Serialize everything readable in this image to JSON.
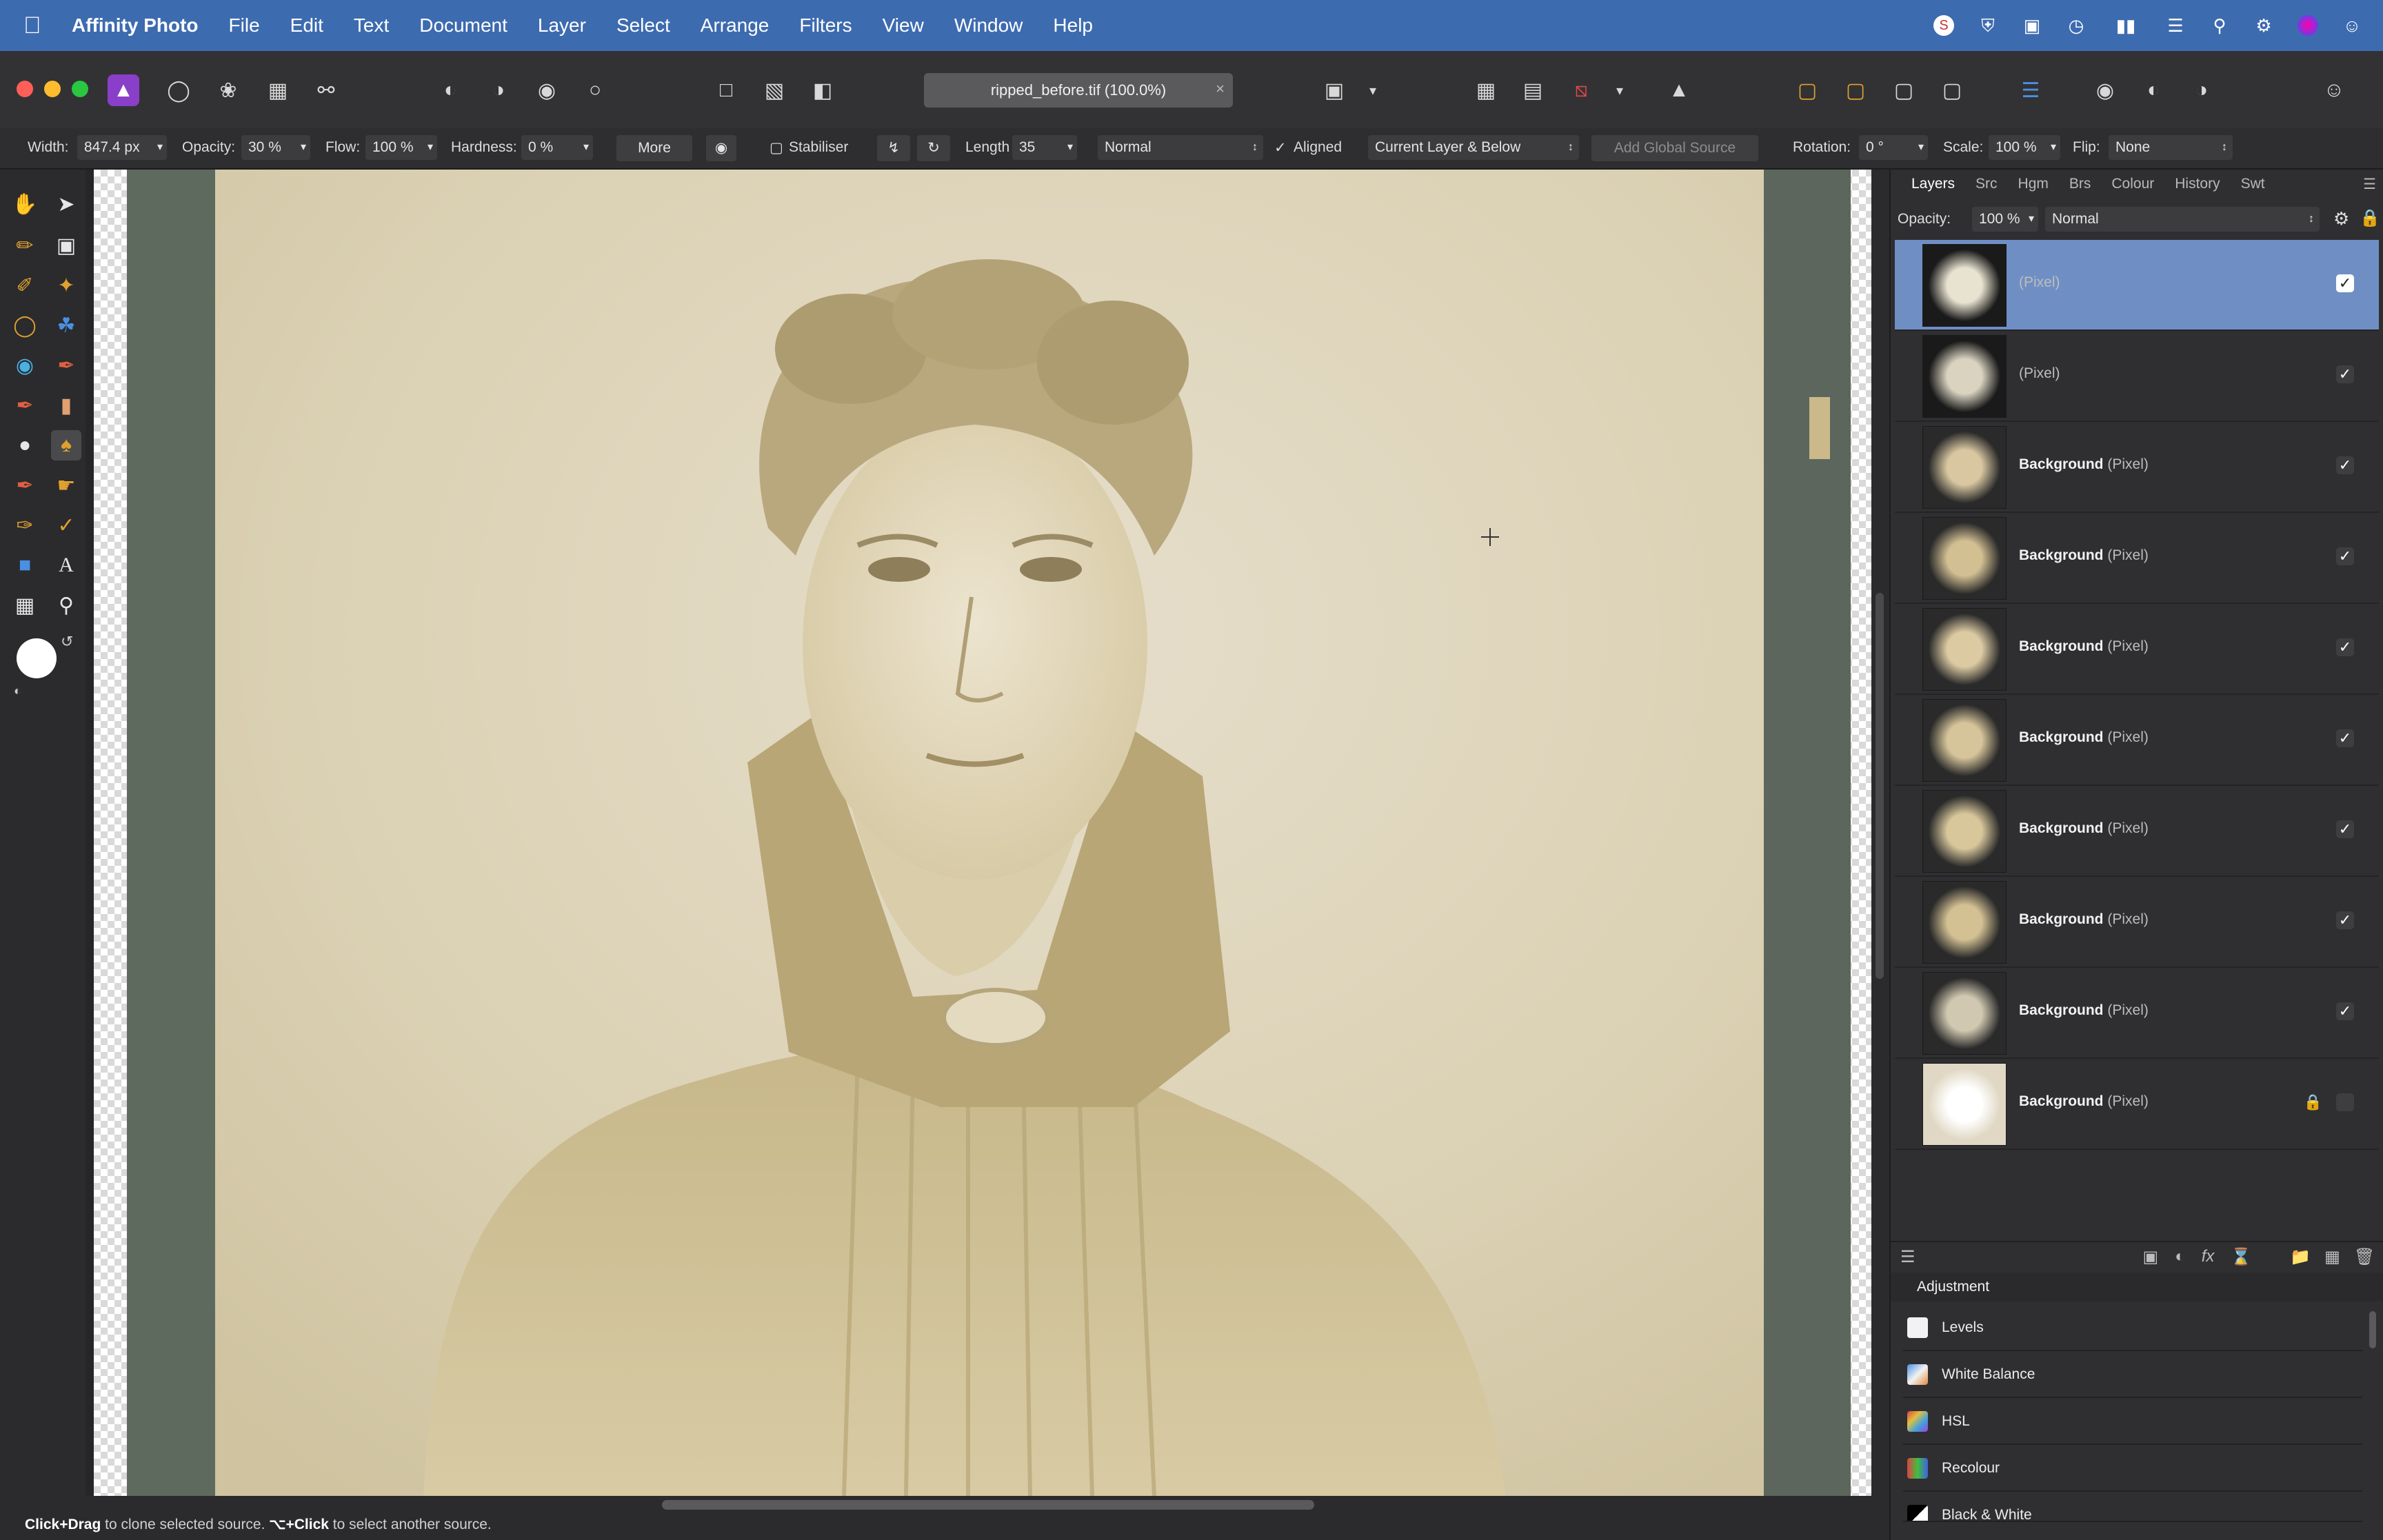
{
  "menubar": {
    "app_name": "Affinity Photo",
    "items": [
      "File",
      "Edit",
      "Text",
      "Document",
      "Layer",
      "Select",
      "Arrange",
      "Filters",
      "View",
      "Window",
      "Help"
    ],
    "status_icons": [
      "scrobble-icon",
      "shield-icon",
      "screen-icon",
      "clock-icon",
      "battery-icon",
      "wifi-icon",
      "search-icon",
      "control-center-icon",
      "siri-icon",
      "user-icon"
    ]
  },
  "toolbar": {
    "document_tab": "ripped_before.tif (100.0%)",
    "tab_close": "×"
  },
  "context": {
    "width_label": "Width:",
    "width_value": "847.4 px",
    "opacity_label": "Opacity:",
    "opacity_value": "30 %",
    "flow_label": "Flow:",
    "flow_value": "100 %",
    "hardness_label": "Hardness:",
    "hardness_value": "0 %",
    "more_label": "More",
    "stabiliser_label": "Stabiliser",
    "length_label": "Length",
    "length_value": "35",
    "blend_mode": "Normal",
    "aligned_label": "Aligned",
    "aligned_check": "✓",
    "sample_source": "Current Layer & Below",
    "add_global_source": "Add Global Source",
    "rotation_label": "Rotation:",
    "rotation_value": "0 °",
    "scale_label": "Scale:",
    "scale_value": "100 %",
    "flip_label": "Flip:",
    "flip_value": "None"
  },
  "panel": {
    "tabs": [
      "Layers",
      "Src",
      "Hgm",
      "Brs",
      "Colour",
      "History",
      "Swt"
    ],
    "opacity_label": "Opacity:",
    "opacity_value": "100 %",
    "blend_mode": "Normal",
    "layers": [
      {
        "name": "",
        "kind": "(Pixel)",
        "visible": "✓",
        "selected": true
      },
      {
        "name": "",
        "kind": "(Pixel)",
        "visible": "✓"
      },
      {
        "name": "Background",
        "kind": "(Pixel)",
        "visible": "✓"
      },
      {
        "name": "Background",
        "kind": "(Pixel)",
        "visible": "✓"
      },
      {
        "name": "Background",
        "kind": "(Pixel)",
        "visible": "✓"
      },
      {
        "name": "Background",
        "kind": "(Pixel)",
        "visible": "✓"
      },
      {
        "name": "Background",
        "kind": "(Pixel)",
        "visible": "✓"
      },
      {
        "name": "Background",
        "kind": "(Pixel)",
        "visible": "✓"
      },
      {
        "name": "Background",
        "kind": "(Pixel)",
        "visible": "✓"
      },
      {
        "name": "Background",
        "kind": "(Pixel)",
        "visible": "",
        "locked": true
      }
    ],
    "adjustment_title": "Adjustment",
    "adjustments": [
      "Levels",
      "White Balance",
      "HSL",
      "Recolour",
      "Black & White"
    ]
  },
  "status": {
    "hint_part1": "Click+Drag",
    "hint_part2": " to clone selected source. ",
    "hint_part3": "⌥+Click",
    "hint_part4": " to select another source."
  },
  "colors": {
    "menubar": "#3d6bb0",
    "selection": "#6f8fc4",
    "sepia_light": "#e3d9bd",
    "sepia_mid": "#cbbb8e",
    "frame": "#5f6a5f"
  }
}
